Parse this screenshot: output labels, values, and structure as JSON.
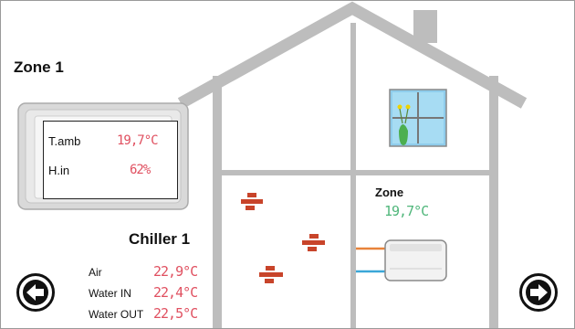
{
  "zone1": {
    "title": "Zone 1",
    "t_amb_label": "T.amb",
    "t_amb_value": "19,7°C",
    "h_in_label": "H.in",
    "h_in_value": "62%"
  },
  "chiller1": {
    "title": "Chiller 1",
    "air_label": "Air",
    "air_value": "22,9°C",
    "water_in_label": "Water IN",
    "water_in_value": "22,4°C",
    "water_out_label": "Water OUT",
    "water_out_value": "22,5°C"
  },
  "zone": {
    "label": "Zone",
    "value": "19,7°C"
  },
  "icons": {
    "back": "arrow-left-icon",
    "forward": "arrow-right-icon",
    "thermostat": "thermostat-icon",
    "window": "window-icon",
    "radiant": "radiant-panel-icon",
    "unit": "fan-coil-icon"
  },
  "colors": {
    "value_red": "#e05060",
    "value_green": "#4fb67a",
    "house_grey": "#bdbdbd",
    "pipe_orange": "#e8833a",
    "pipe_blue": "#3aa7d8",
    "brick": "#c8442a"
  }
}
